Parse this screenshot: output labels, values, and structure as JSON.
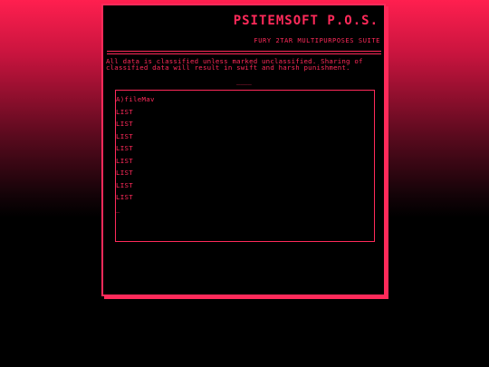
{
  "terminal": {
    "title": "PSITEMSOFT P.O.S.",
    "subtitle": "FURY 2TAR MULTIPURPOSES SUITE",
    "notice_line1": "All data is classified unless marked unclassified. Sharing of",
    "notice_line2": "classified data will result in swift and harsh punishment.",
    "divider": "____",
    "menu": {
      "items": [
        {
          "label": "A)fileMav"
        },
        {
          "label": "LIST"
        },
        {
          "label": "LIST"
        },
        {
          "label": "LIST"
        },
        {
          "label": "LIST"
        },
        {
          "label": "LIST"
        },
        {
          "label": "LIST"
        },
        {
          "label": "LIST"
        },
        {
          "label": "LIST"
        }
      ],
      "cursor": "_"
    }
  },
  "colors": {
    "accent": "#ff2a5a",
    "background_top": "#ff1f4f",
    "background_bottom": "#000000",
    "terminal_bg": "#000000"
  }
}
